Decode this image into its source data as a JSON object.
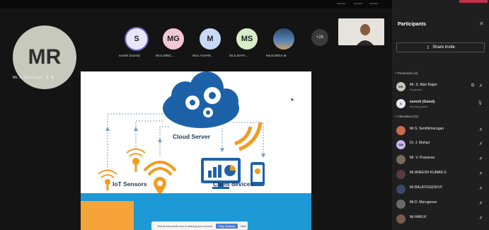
{
  "stage": {
    "main_avatar": {
      "initials": "MR",
      "name": "Mr. S. Mari Rajan"
    },
    "attendees": [
      {
        "initials": "S",
        "name": "suresh (Guest)",
        "color": "#e8e6f8",
        "ring": true
      },
      {
        "initials": "MG",
        "name": "Mr.S.WINC...",
        "color": "#f4c7d7",
        "ring": false
      },
      {
        "initials": "M",
        "name": "Mr.K.YUVAR...",
        "color": "#c9d8f7",
        "ring": false
      },
      {
        "initials": "MS",
        "name": "Mr.S.SHYA...",
        "color": "#d7ecc9",
        "ring": false
      },
      {
        "initials": "",
        "name": "Ms.DURGA.M",
        "color": "#4a6f96",
        "ring": false
      }
    ],
    "more_count": "+26"
  },
  "slide": {
    "cloud_label": "Cloud Server",
    "iot_label": "IoT Sensors",
    "client_label": "Client devices",
    "share_notice": "Teams.microsoft.com is sharing your screen.",
    "stop_sharing": "Stop sharing",
    "hide": "Hide"
  },
  "panel": {
    "title": "Participants",
    "share_invite": "Share invite",
    "presenters_heading": "Presenters (2)",
    "attendees_heading": "Attendees (31)",
    "presenters": [
      {
        "initials": "MR",
        "name": "Mr. S. Mari Rajan",
        "role": "Organizer",
        "color": "#c7c9bd"
      },
      {
        "initials": "S",
        "name": "suresh (Guest)",
        "role": "Meeting guest",
        "color": "#e8e6f8"
      }
    ],
    "attendees": [
      {
        "initials": "",
        "name": "Mr.S. Senthilmurugan",
        "color": "#c96a4f"
      },
      {
        "initials": "DM",
        "name": "Dr. J. Mohan",
        "color": "#c7b3f0"
      },
      {
        "initials": "",
        "name": "Mr. V. Prasanan",
        "color": "#7a6a58"
      },
      {
        "initials": "",
        "name": "Mr.ANEESH KUMAR.S",
        "color": "#5a3b3b"
      },
      {
        "initials": "",
        "name": "Mr.BALAYOGESH.R",
        "color": "#3b4a6a"
      },
      {
        "initials": "",
        "name": "Mr.D. Murugesan",
        "color": "#6a6a6a"
      },
      {
        "initials": "",
        "name": "Mr.HARI.K",
        "color": "#7b5a4a"
      }
    ]
  }
}
